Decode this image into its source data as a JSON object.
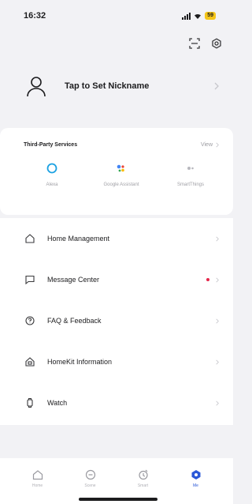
{
  "status_bar": {
    "time": "16:32",
    "battery": "59"
  },
  "top_actions": {
    "icons": [
      "scan-icon",
      "settings-icon"
    ]
  },
  "profile": {
    "nickname": "Tap to Set Nickname"
  },
  "third_party": {
    "title": "Third-Party Services",
    "more_label": "View",
    "items": [
      {
        "label": "Alexa",
        "icon": "alexa-icon"
      },
      {
        "label": "Google Assistant",
        "icon": "google-assistant-icon"
      },
      {
        "label": "SmartThings",
        "icon": "smartthings-icon"
      }
    ]
  },
  "menu": {
    "items": [
      {
        "label": "Home Management",
        "icon": "home-icon"
      },
      {
        "label": "Message Center",
        "icon": "message-icon",
        "badge": true
      },
      {
        "label": "FAQ & Feedback",
        "icon": "faq-icon"
      },
      {
        "label": "HomeKit Information",
        "icon": "homekit-icon"
      },
      {
        "label": "Watch",
        "icon": "watch-icon"
      }
    ]
  },
  "tabbar": {
    "tabs": [
      {
        "label": "Home",
        "icon": "home-tab-icon"
      },
      {
        "label": "Scene",
        "icon": "scene-tab-icon"
      },
      {
        "label": "Smart",
        "icon": "smart-tab-icon"
      },
      {
        "label": "Me",
        "icon": "me-tab-icon",
        "active": true
      }
    ]
  },
  "colors": {
    "accent": "#2b58d8",
    "badge": "#e5254a",
    "battery": "#f5c518",
    "background": "#f2f2f5"
  }
}
